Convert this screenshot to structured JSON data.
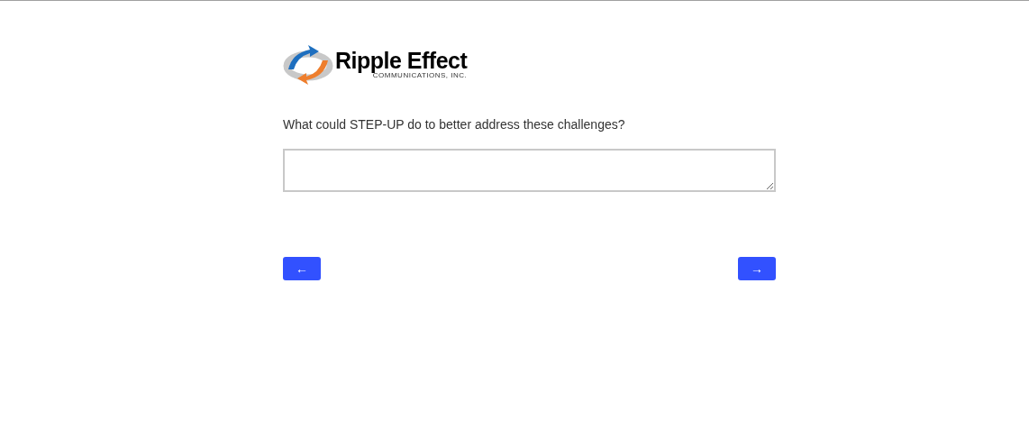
{
  "logo": {
    "name": "Ripple Effect",
    "tagline": "COMMUNICATIONS, INC."
  },
  "question": {
    "text": "What could STEP-UP do to better address these challenges?"
  },
  "navigation": {
    "back": "←",
    "next": "→"
  }
}
